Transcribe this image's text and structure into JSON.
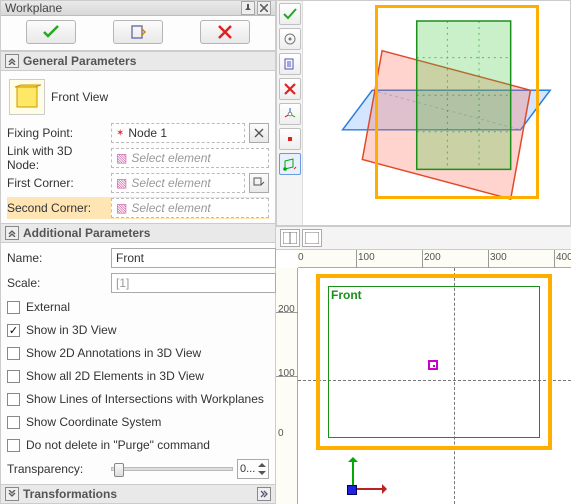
{
  "titlebar": {
    "title": "Workplane",
    "pin_icon": "pin-icon",
    "close_icon": "close-icon"
  },
  "action_buttons": {
    "ok_icon": "check-green",
    "new_icon": "page-icon",
    "cancel_icon": "cross-red"
  },
  "sections": {
    "general": {
      "label": "General Parameters"
    },
    "additional": {
      "label": "Additional Parameters"
    },
    "transforms": {
      "label": "Transformations"
    }
  },
  "view_row": {
    "label": "Front View"
  },
  "rows": {
    "fixing_point": {
      "label": "Fixing Point:",
      "value": "Node 1"
    },
    "link_3d_node": {
      "label": "Link with 3D Node:",
      "placeholder": "Select element"
    },
    "first_corner": {
      "label": "First Corner:",
      "placeholder": "Select element"
    },
    "second_corner": {
      "label": "Second Corner:",
      "placeholder": "Select element"
    }
  },
  "name": {
    "label": "Name:",
    "value": "Front"
  },
  "scale": {
    "label": "Scale:",
    "value": "[1]"
  },
  "checks": {
    "external": {
      "label": "External",
      "checked": false
    },
    "show3d": {
      "label": "Show in 3D View",
      "checked": true
    },
    "show2dAnnot": {
      "label": "Show 2D Annotations in 3D View",
      "checked": false
    },
    "showAll2d": {
      "label": "Show all 2D Elements in 3D View",
      "checked": false
    },
    "intersections": {
      "label": "Show Lines of Intersections with Workplanes",
      "checked": false
    },
    "coordSys": {
      "label": "Show Coordinate System",
      "checked": false
    },
    "noPurge": {
      "label": "Do not delete in \"Purge\" command",
      "checked": false
    }
  },
  "transparency": {
    "label": "Transparency:",
    "value": "0..."
  },
  "view3d_toolbar": [
    {
      "name": "check-icon"
    },
    {
      "name": "settings-icon"
    },
    {
      "name": "preview-icon"
    },
    {
      "name": "cancel-icon"
    },
    {
      "name": "axis-icon"
    },
    {
      "name": "point-icon"
    },
    {
      "name": "plane-icon"
    }
  ],
  "ruler_h": [
    "0",
    "100",
    "200",
    "300",
    "400"
  ],
  "ruler_v": [
    "0",
    "100",
    "200"
  ],
  "canvas2d": {
    "label": "Front"
  },
  "chart_data": null
}
